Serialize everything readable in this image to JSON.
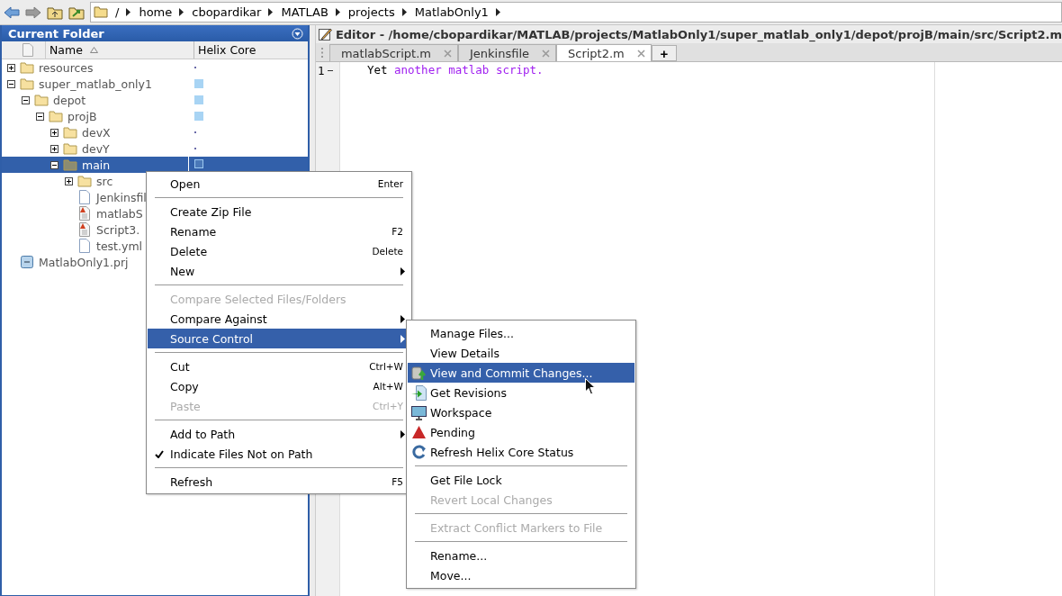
{
  "breadcrumb": [
    "/",
    "home",
    "cbopardikar",
    "MATLAB",
    "projects",
    "MatlabOnly1"
  ],
  "current_folder": {
    "title": "Current Folder",
    "columns": [
      "Name",
      "Helix Core"
    ],
    "tree": [
      {
        "name": "resources",
        "kind": "folder",
        "expanded": false,
        "tracked": false,
        "selected": false
      },
      {
        "name": "super_matlab_only1",
        "kind": "folder",
        "expanded": true,
        "tracked": true,
        "selected": false,
        "children": [
          {
            "name": "depot",
            "kind": "folder",
            "expanded": true,
            "tracked": true,
            "selected": false,
            "children": [
              {
                "name": "projB",
                "kind": "folder",
                "expanded": true,
                "tracked": true,
                "selected": false,
                "children": [
                  {
                    "name": "devX",
                    "kind": "folder",
                    "expanded": false,
                    "tracked": false,
                    "selected": false
                  },
                  {
                    "name": "devY",
                    "kind": "folder",
                    "expanded": false,
                    "tracked": false,
                    "selected": false
                  },
                  {
                    "name": "main",
                    "kind": "folder",
                    "expanded": true,
                    "tracked": true,
                    "selected": true,
                    "children": [
                      {
                        "name": "src",
                        "kind": "folder",
                        "expanded": false,
                        "selected": false
                      },
                      {
                        "name": "Jenkinsfil",
                        "kind": "file",
                        "selected": false
                      },
                      {
                        "name": "matlabS",
                        "kind": "mfile",
                        "selected": false
                      },
                      {
                        "name": "Script3.",
                        "kind": "mfile",
                        "selected": false
                      },
                      {
                        "name": "test.yml",
                        "kind": "file",
                        "selected": false
                      }
                    ]
                  }
                ]
              }
            ]
          }
        ]
      },
      {
        "name": "MatlabOnly1.prj",
        "kind": "project",
        "selected": false
      }
    ]
  },
  "editor": {
    "title": "Editor - /home/cbopardikar/MATLAB/projects/MatlabOnly1/super_matlab_only1/depot/projB/main/src/Script2.m",
    "tabs": [
      {
        "label": "matlabScript.m",
        "selected": false
      },
      {
        "label": "Jenkinsfile",
        "selected": false
      },
      {
        "label": "Script2.m",
        "selected": true
      }
    ],
    "new_tab": "+",
    "lines": [
      {
        "number": "1",
        "code": [
          {
            "text": "Yet ",
            "kind": "plain"
          },
          {
            "text": "another matlab script.",
            "kind": "string"
          }
        ]
      }
    ]
  },
  "context_menu": [
    {
      "kind": "item",
      "label": "Open",
      "shortcut": "Enter",
      "disabled": false,
      "selected": false,
      "has_submenu": false,
      "checked": false
    },
    {
      "kind": "separator"
    },
    {
      "kind": "item",
      "label": "Create Zip File",
      "disabled": false,
      "selected": false,
      "has_submenu": false,
      "checked": false
    },
    {
      "kind": "item",
      "label": "Rename",
      "shortcut": "F2",
      "disabled": false,
      "selected": false,
      "has_submenu": false,
      "checked": false
    },
    {
      "kind": "item",
      "label": "Delete",
      "shortcut": "Delete",
      "disabled": false,
      "selected": false,
      "has_submenu": false,
      "checked": false
    },
    {
      "kind": "item",
      "label": "New",
      "disabled": false,
      "selected": false,
      "has_submenu": true,
      "checked": false
    },
    {
      "kind": "separator"
    },
    {
      "kind": "item",
      "label": "Compare Selected Files/Folders",
      "disabled": true,
      "selected": false,
      "has_submenu": false,
      "checked": false
    },
    {
      "kind": "item",
      "label": "Compare Against",
      "disabled": false,
      "selected": false,
      "has_submenu": true,
      "checked": false
    },
    {
      "kind": "item",
      "label": "Source Control",
      "disabled": false,
      "selected": true,
      "has_submenu": true,
      "checked": false
    },
    {
      "kind": "separator"
    },
    {
      "kind": "item",
      "label": "Cut",
      "shortcut": "Ctrl+W",
      "disabled": false,
      "selected": false,
      "has_submenu": false,
      "checked": false
    },
    {
      "kind": "item",
      "label": "Copy",
      "shortcut": "Alt+W",
      "disabled": false,
      "selected": false,
      "has_submenu": false,
      "checked": false
    },
    {
      "kind": "item",
      "label": "Paste",
      "shortcut": "Ctrl+Y",
      "disabled": true,
      "selected": false,
      "has_submenu": false,
      "checked": false
    },
    {
      "kind": "separator"
    },
    {
      "kind": "item",
      "label": "Add to Path",
      "disabled": false,
      "selected": false,
      "has_submenu": true,
      "checked": false
    },
    {
      "kind": "item",
      "label": "Indicate Files Not on Path",
      "disabled": false,
      "selected": false,
      "has_submenu": false,
      "checked": true
    },
    {
      "kind": "separator"
    },
    {
      "kind": "item",
      "label": "Refresh",
      "shortcut": "F5",
      "disabled": false,
      "selected": false,
      "has_submenu": false,
      "checked": false
    }
  ],
  "source_control_menu": [
    {
      "kind": "item",
      "label": "Manage Files...",
      "disabled": false,
      "selected": false
    },
    {
      "kind": "item",
      "label": "View Details",
      "disabled": false,
      "selected": false
    },
    {
      "kind": "item",
      "label": "View and Commit Changes...",
      "disabled": false,
      "selected": true
    },
    {
      "kind": "item",
      "label": "Get Revisions",
      "disabled": false,
      "selected": false
    },
    {
      "kind": "item",
      "label": "Workspace",
      "disabled": false,
      "selected": false
    },
    {
      "kind": "item",
      "label": "Pending",
      "disabled": false,
      "selected": false
    },
    {
      "kind": "item",
      "label": "Refresh Helix Core Status",
      "disabled": false,
      "selected": false
    },
    {
      "kind": "separator"
    },
    {
      "kind": "item",
      "label": "Get File Lock",
      "disabled": false,
      "selected": false
    },
    {
      "kind": "item",
      "label": "Revert Local Changes",
      "disabled": true,
      "selected": false
    },
    {
      "kind": "separator"
    },
    {
      "kind": "item",
      "label": "Extract Conflict Markers to File",
      "disabled": true,
      "selected": false
    },
    {
      "kind": "separator"
    },
    {
      "kind": "item",
      "label": "Rename...",
      "disabled": false,
      "selected": false
    },
    {
      "kind": "item",
      "label": "Move...",
      "disabled": false,
      "selected": false
    }
  ]
}
